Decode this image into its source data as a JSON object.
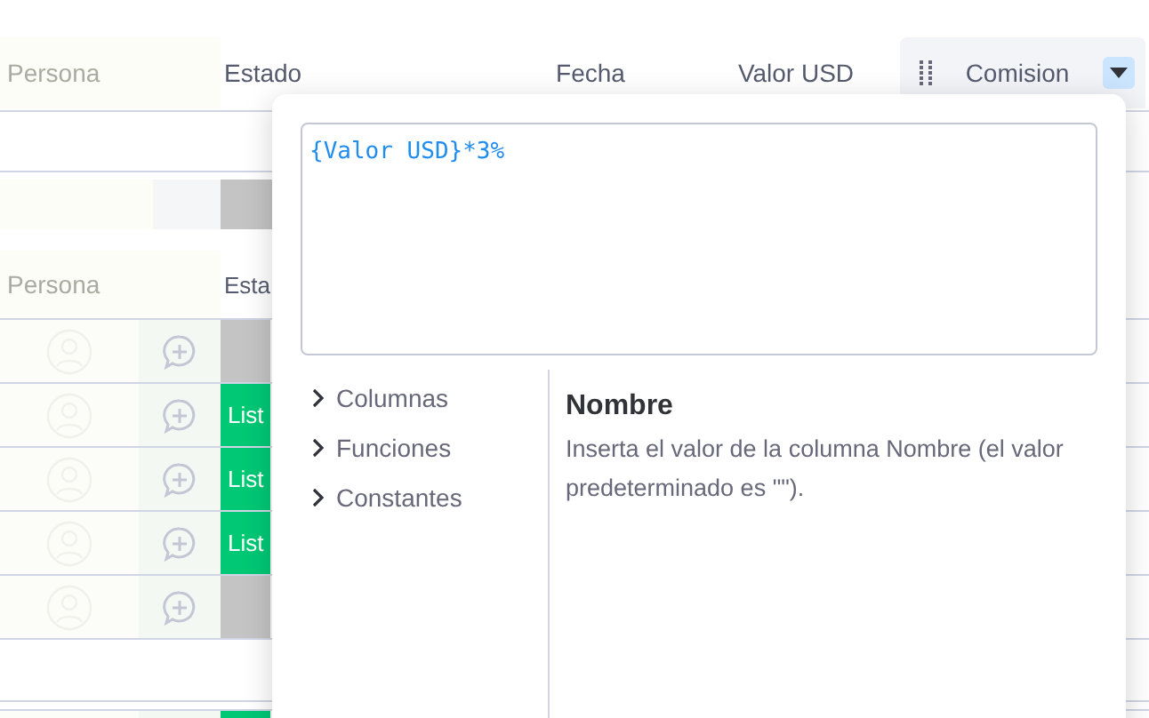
{
  "board": {
    "columns": [
      "Persona",
      "Estado",
      "Fecha",
      "Valor USD",
      "Comision"
    ],
    "column_menu": {
      "open": true
    },
    "group": {
      "columns": [
        "Persona",
        "Esta"
      ],
      "rows": [
        {
          "color": "#c4c4c4"
        },
        {
          "status": "List",
          "color": "#00c875"
        },
        {
          "status": "List",
          "color": "#00c875"
        },
        {
          "status": "List",
          "color": "#00c875"
        },
        {
          "color": "#c4c4c4"
        }
      ]
    },
    "next_row": {
      "color": "#00c875"
    }
  },
  "formula_editor": {
    "open": true,
    "value": "{Valor USD}*3%",
    "sections": [
      {
        "label": "Columnas",
        "expanded": false
      },
      {
        "label": "Funciones",
        "expanded": false
      },
      {
        "label": "Constantes",
        "expanded": false
      }
    ],
    "info": {
      "title": "Nombre",
      "description": "Inserta el valor de la columna Nombre (el valor predeterminado es \"\")."
    }
  }
}
